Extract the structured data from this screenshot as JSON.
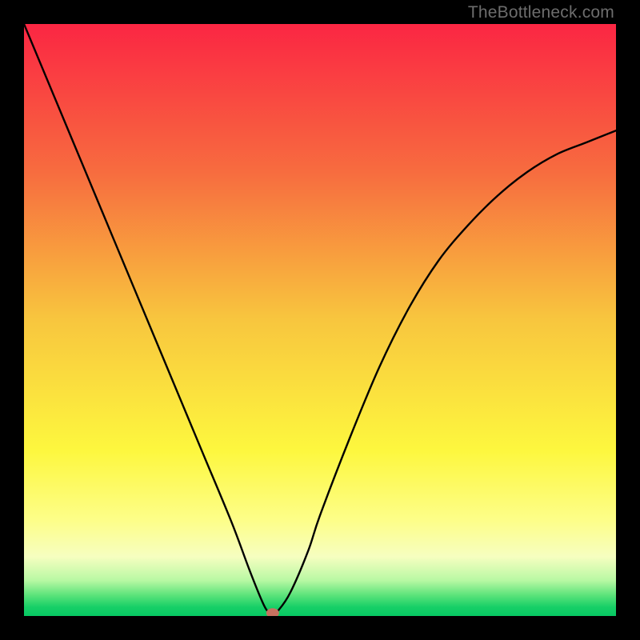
{
  "watermark": "TheBottleneck.com",
  "chart_data": {
    "type": "line",
    "title": "",
    "xlabel": "",
    "ylabel": "",
    "xlim": [
      0,
      100
    ],
    "ylim": [
      0,
      100
    ],
    "grid": false,
    "legend": false,
    "series": [
      {
        "name": "bottleneck-curve",
        "x": [
          0,
          5,
          10,
          15,
          20,
          25,
          30,
          35,
          38,
          40,
          41,
          42,
          43,
          45,
          48,
          50,
          55,
          60,
          65,
          70,
          75,
          80,
          85,
          90,
          95,
          100
        ],
        "y": [
          100,
          88,
          76,
          64,
          52,
          40,
          28,
          16,
          8,
          3,
          1,
          0.5,
          1,
          4,
          11,
          17,
          30,
          42,
          52,
          60,
          66,
          71,
          75,
          78,
          80,
          82
        ]
      }
    ],
    "markers": [
      {
        "name": "optimum-point",
        "x": 42,
        "y": 0.5,
        "color": "#c77160"
      }
    ],
    "background_gradient": {
      "stops": [
        {
          "offset": 0.0,
          "color": "#fb2643"
        },
        {
          "offset": 0.25,
          "color": "#f76c3f"
        },
        {
          "offset": 0.5,
          "color": "#f8c63e"
        },
        {
          "offset": 0.72,
          "color": "#fdf73e"
        },
        {
          "offset": 0.84,
          "color": "#fdfe8a"
        },
        {
          "offset": 0.9,
          "color": "#f6fec0"
        },
        {
          "offset": 0.94,
          "color": "#b8f8a3"
        },
        {
          "offset": 0.965,
          "color": "#5be37a"
        },
        {
          "offset": 0.985,
          "color": "#17cf67"
        },
        {
          "offset": 1.0,
          "color": "#07c863"
        }
      ]
    }
  }
}
